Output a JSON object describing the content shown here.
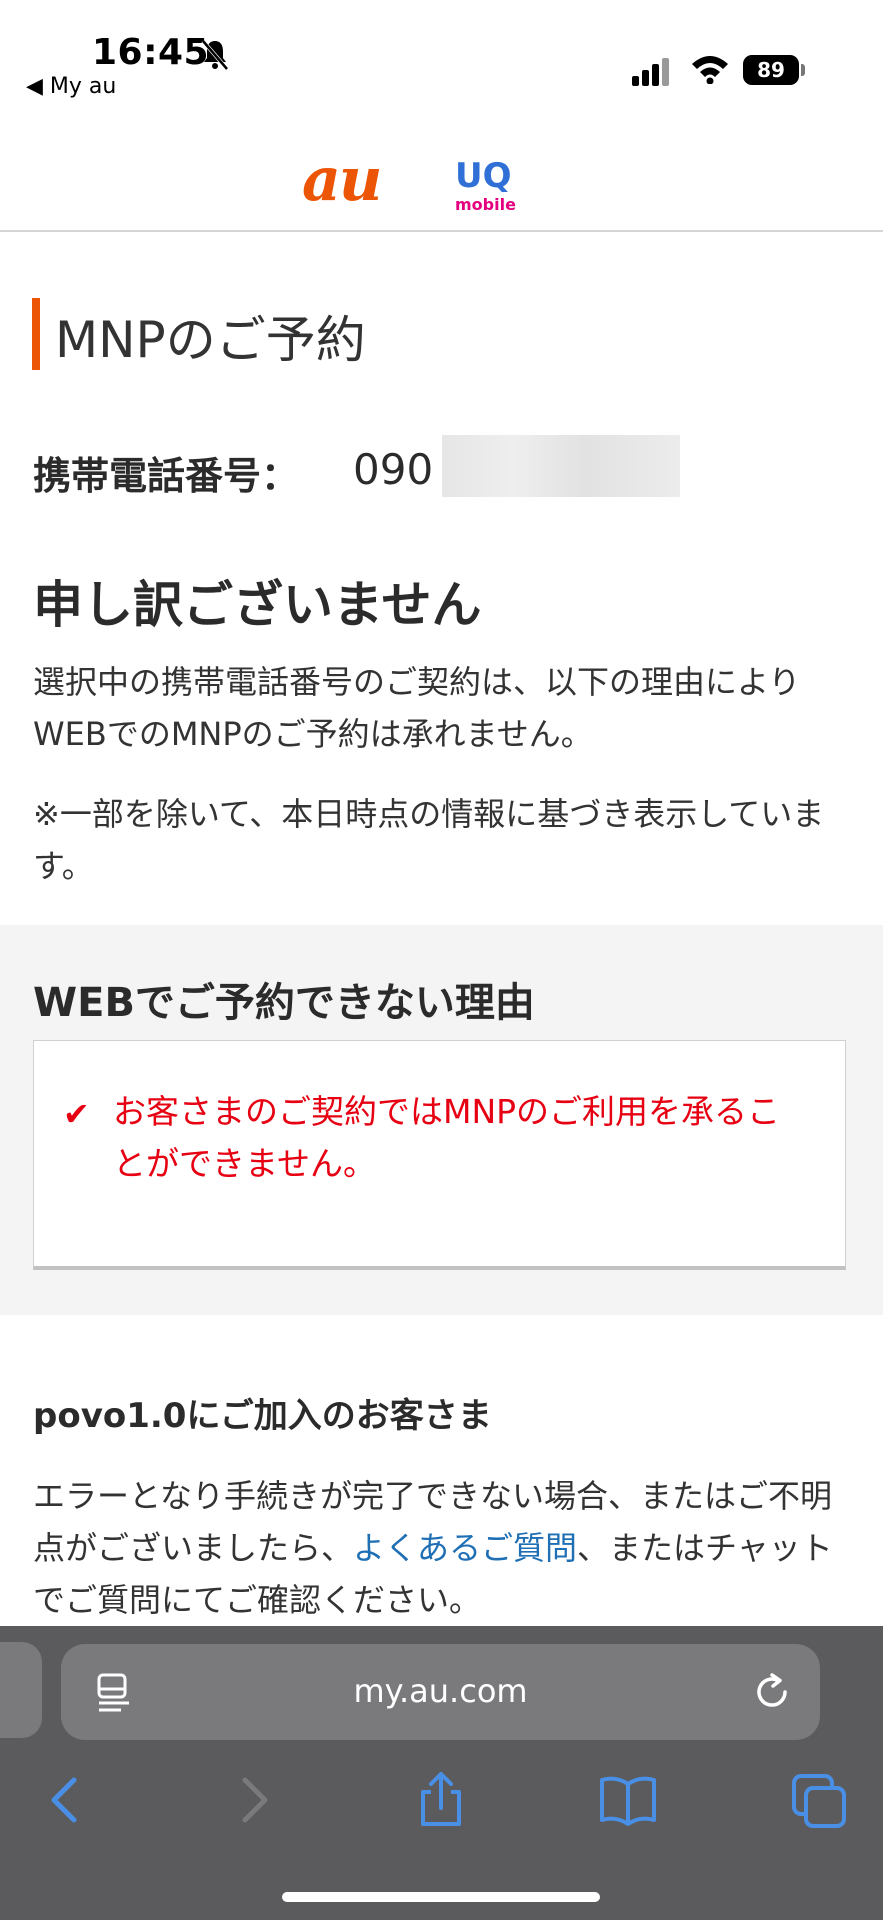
{
  "status_bar": {
    "time": "16:45",
    "back_app": "◀ My au",
    "battery": "89"
  },
  "header": {
    "logo_au": "au",
    "logo_uq": "UQ",
    "logo_uq_sub": "mobile"
  },
  "page": {
    "title": "MNPのご予約",
    "phone_label": "携帯電話番号：",
    "phone_value": "090",
    "sorry_heading": "申し訳ございません",
    "message": "選択中の携帯電話番号のご契約は、以下の理由によりWEBでのMNPのご予約は承れません。",
    "note": "※一部を除いて、本日時点の情報に基づき表示しています。"
  },
  "reasons": {
    "heading": "WEBでご予約できない理由",
    "items": [
      "お客さまのご契約ではMNPのご利用を承ることができません。"
    ]
  },
  "povo": {
    "heading": "povo1.0にご加入のお客さま",
    "text_before": "エラーとなり手続きが完了できない場合、またはご不明点がございましたら、",
    "link": "よくあるご質問",
    "text_after": "、またはチャットでご質問にてご確認ください。"
  },
  "browser": {
    "url": "my.au.com"
  },
  "colors": {
    "brand_orange": "#eb5505",
    "error_red": "#e60012",
    "link_blue": "#1f6fb5",
    "safari_icon_blue": "#4a8fe6"
  }
}
